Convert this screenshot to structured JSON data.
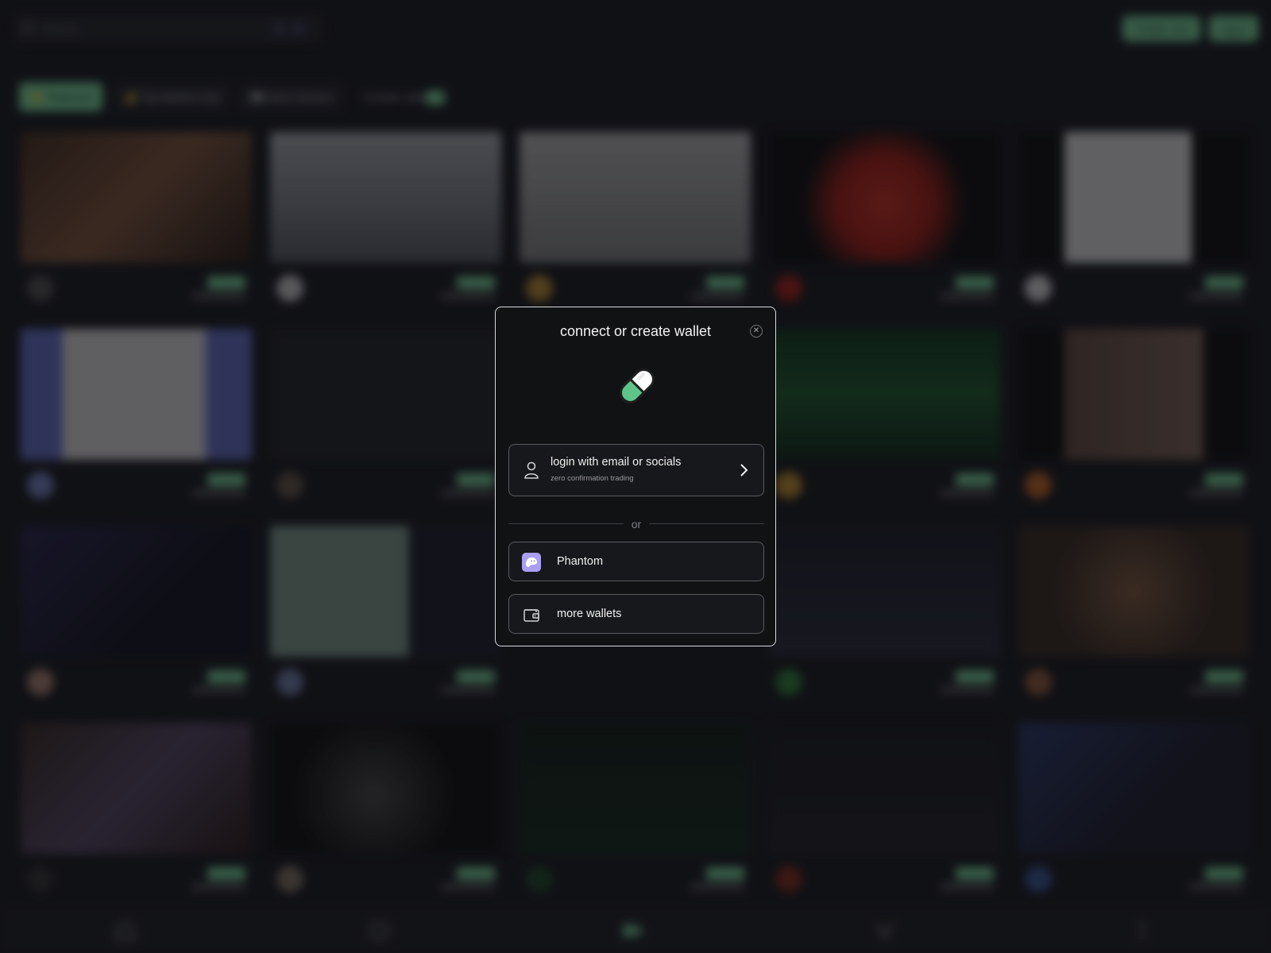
{
  "header": {
    "search_placeholder": "Search...",
    "create_coin_label": "Create coin",
    "login_label": "Log in"
  },
  "filters": {
    "featured": "🌟 Featured",
    "top_market_cap": "💰 Top Market Cap",
    "most_viewers": "👀 Most Viewers",
    "include_nsfw": "Include nsfw"
  },
  "colors": {
    "accent": "#86efac",
    "modal_border": "#d9d9dd",
    "phantom": "#ab9ff2"
  },
  "modal": {
    "title": "connect or create wallet",
    "email_option": {
      "label": "login with email or socials",
      "sublabel": "zero confirmation trading"
    },
    "divider_text": "or",
    "phantom_label": "Phantom",
    "more_wallets_label": "more wallets",
    "icons": [
      "pill-logo-icon",
      "user-icon",
      "chevron-right-icon",
      "phantom-icon",
      "wallet-icon",
      "close-icon"
    ]
  }
}
